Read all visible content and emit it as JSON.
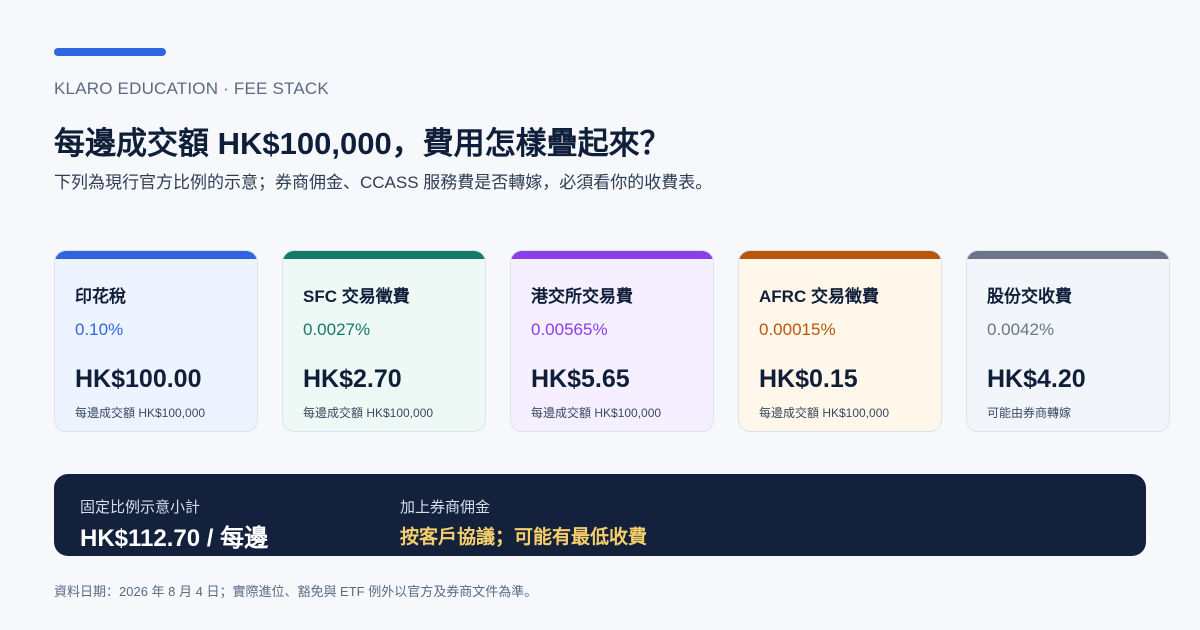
{
  "header": {
    "eyebrow": "KLARO EDUCATION · FEE STACK",
    "title": "每邊成交額 HK$100,000，費用怎樣疊起來？",
    "subtitle": "下列為現行官方比例的示意；券商佣金、CCASS 服務費是否轉嫁，必須看你的收費表。"
  },
  "cards": [
    {
      "title": "印花稅",
      "rate": "0.10%",
      "amount": "HK$100.00",
      "note": "每邊成交額 HK$100,000",
      "accent": "#2f66e0",
      "bg": "#eef4ff"
    },
    {
      "title": "SFC 交易徵費",
      "rate": "0.0027%",
      "amount": "HK$2.70",
      "note": "每邊成交額 HK$100,000",
      "accent": "#117a68",
      "bg": "#eef9f5"
    },
    {
      "title": "港交所交易費",
      "rate": "0.00565%",
      "amount": "HK$5.65",
      "note": "每邊成交額 HK$100,000",
      "accent": "#8a3ee8",
      "bg": "#f5efff"
    },
    {
      "title": "AFRC 交易徵費",
      "rate": "0.00015%",
      "amount": "HK$0.15",
      "note": "每邊成交額 HK$100,000",
      "accent": "#b8560b",
      "bg": "#fff7ea"
    },
    {
      "title": "股份交收費",
      "rate": "0.0042%",
      "amount": "HK$4.20",
      "note": "可能由券商轉嫁",
      "accent": "#6b7689",
      "bg": "#f2f5f9"
    }
  ],
  "summary": {
    "subtotal_label": "固定比例示意小計",
    "subtotal_value": "HK$112.70 / 每邊",
    "commission_label": "加上券商佣金",
    "commission_value": "按客戶協議；可能有最低收費",
    "bg": "#13213d",
    "highlight": "#f6cf6a"
  },
  "footnote": "資料日期：2026 年 8 月 4 日；實際進位、豁免與 ETF 例外以官方及券商文件為準。",
  "colors": {
    "page_bg": "#f6f8fc",
    "accent": "#2f66e0"
  }
}
